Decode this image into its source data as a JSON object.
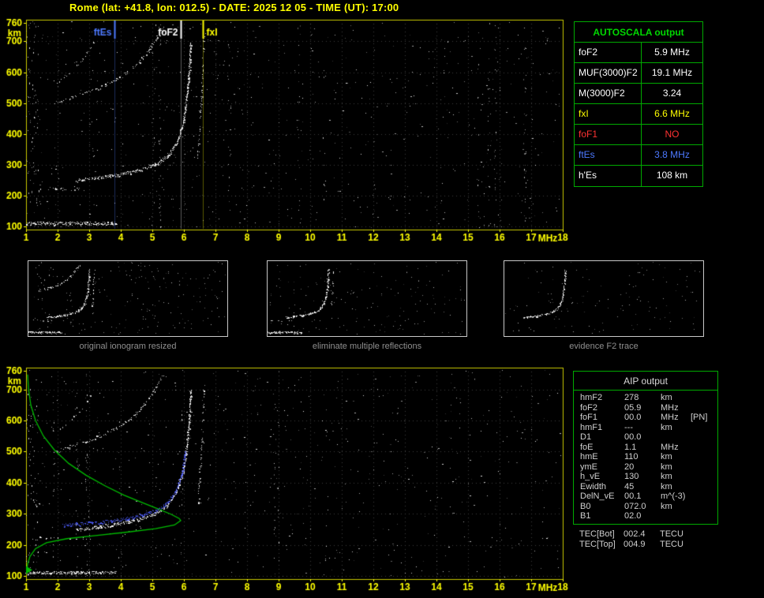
{
  "header": {
    "title": "Rome (lat: +41.8, lon: 012.5) - DATE: 2025 12 05 - TIME (UT): 17:00"
  },
  "colors": {
    "axis_yellow": "#ffff00",
    "plot_border": "#c8c800",
    "table_border_green": "#00aa00",
    "header_green": "#00d800",
    "value_white": "#ffffff",
    "value_yellow": "#ffff00",
    "value_red": "#ff3232",
    "value_blue": "#4d79ff",
    "caption_gray": "#8f8f8f",
    "profile_green": "#00bb00",
    "trace_blue": "#4d5dff"
  },
  "autoscala": {
    "header": "AUTOSCALA output",
    "rows": [
      {
        "label": "foF2",
        "value": "5.9",
        "unit": "MHz",
        "color": "#ffffff"
      },
      {
        "label": "MUF(3000)F2",
        "value": "19.1",
        "unit": "MHz",
        "color": "#ffffff"
      },
      {
        "label": "M(3000)F2",
        "value": "3.24",
        "unit": "",
        "color": "#ffffff"
      },
      {
        "label": "fxI",
        "value": "6.6",
        "unit": "MHz",
        "color": "#ffff00"
      },
      {
        "label": "foF1",
        "value": "NO",
        "unit": "",
        "color": "#ff3232"
      },
      {
        "label": "ftEs",
        "value": "3.8",
        "unit": "MHz",
        "color": "#4d79ff"
      },
      {
        "label": "h'Es",
        "value": "108",
        "unit": "km",
        "color": "#ffffff"
      }
    ]
  },
  "aip": {
    "header": "AIP output",
    "rows": [
      {
        "label": "hmF2",
        "value": "278",
        "unit": "km",
        "extra": ""
      },
      {
        "label": "foF2",
        "value": "05.9",
        "unit": "MHz",
        "extra": ""
      },
      {
        "label": "foF1",
        "value": "00.0",
        "unit": "MHz",
        "extra": "[PN]"
      },
      {
        "label": "hmF1",
        "value": "---",
        "unit": "km",
        "extra": ""
      },
      {
        "label": "D1",
        "value": "00.0",
        "unit": "",
        "extra": ""
      },
      {
        "label": "foE",
        "value": "1.1",
        "unit": "MHz",
        "extra": ""
      },
      {
        "label": "hmE",
        "value": "110",
        "unit": "km",
        "extra": ""
      },
      {
        "label": "ymE",
        "value": "20",
        "unit": "km",
        "extra": ""
      },
      {
        "label": "h_vE",
        "value": "130",
        "unit": "km",
        "extra": ""
      },
      {
        "label": "Ewidth",
        "value": "45",
        "unit": "km",
        "extra": ""
      },
      {
        "label": "DelN_vE",
        "value": "00.1",
        "unit": "m^(-3)",
        "extra": ""
      },
      {
        "label": "B0",
        "value": "072.0",
        "unit": "km",
        "extra": ""
      },
      {
        "label": "B1",
        "value": "02.0",
        "unit": "",
        "extra": ""
      }
    ],
    "tec_rows": [
      {
        "label": "TEC[Bot]",
        "value": "002.4",
        "unit": "TECU"
      },
      {
        "label": "TEC[Top]",
        "value": "004.9",
        "unit": "TECU"
      }
    ]
  },
  "chart_data": [
    {
      "id": "top_ionogram",
      "type": "scatter",
      "title": "ionogram with autoscaled characteristics",
      "xlabel": "MHz",
      "ylabel": "km",
      "xlim": [
        1,
        18
      ],
      "ylim": [
        90,
        770
      ],
      "xticks": [
        1,
        2,
        3,
        4,
        5,
        6,
        7,
        8,
        9,
        10,
        11,
        12,
        13,
        14,
        15,
        16,
        17,
        18
      ],
      "yticks": [
        100,
        200,
        300,
        400,
        500,
        600,
        700,
        760
      ],
      "grid": true,
      "legend": "none",
      "markers": [
        {
          "label": "ftEs",
          "freq": 3.8,
          "color": "#4d79ff",
          "side": "left"
        },
        {
          "label": "foF2",
          "freq": 5.9,
          "color": "#ffffff",
          "side": "left"
        },
        {
          "label": "fxI",
          "freq": 6.6,
          "color": "#ffff00",
          "side": "right"
        }
      ],
      "traces": {
        "es": {
          "points": [
            [
              1.0,
              110
            ],
            [
              3.85,
              110
            ]
          ],
          "density": 0.95,
          "thick": 2,
          "passes": 2
        },
        "es_multiple": {
          "points": [
            [
              1.2,
              220
            ],
            [
              3.1,
              222
            ]
          ],
          "density": 0.3,
          "thick": 2
        },
        "f2": {
          "points": [
            [
              2.6,
              248
            ],
            [
              3.2,
              256
            ],
            [
              4.0,
              268
            ],
            [
              4.6,
              282
            ],
            [
              5.1,
              300
            ],
            [
              5.5,
              328
            ],
            [
              5.8,
              375
            ],
            [
              6.0,
              440
            ],
            [
              6.1,
              520
            ],
            [
              6.18,
              600
            ],
            [
              6.22,
              695
            ]
          ],
          "density": 0.9,
          "thick": 2,
          "passes": 2
        },
        "f2_multiple": {
          "points": [
            [
              1.9,
              498
            ],
            [
              2.4,
              515
            ],
            [
              2.9,
              532
            ],
            [
              3.4,
              552
            ],
            [
              3.9,
              577
            ],
            [
              4.3,
              605
            ],
            [
              4.6,
              635
            ],
            [
              4.9,
              672
            ],
            [
              5.15,
              710
            ],
            [
              5.35,
              745
            ]
          ],
          "density": 0.65,
          "thick": 2
        },
        "f2_multiple3": {
          "points": [
            [
              2.0,
              565
            ],
            [
              2.4,
              600
            ],
            [
              2.8,
              640
            ],
            [
              3.1,
              685
            ],
            [
              3.3,
              730
            ]
          ],
          "density": 0.22,
          "thick": 1
        },
        "x_mode": {
          "points": [
            [
              6.45,
              320
            ],
            [
              6.52,
              440
            ],
            [
              6.58,
              560
            ],
            [
              6.62,
              660
            ],
            [
              6.65,
              715
            ]
          ],
          "density": 0.4,
          "thick": 1
        }
      },
      "noise": {
        "dots": 650,
        "left_band_dots": 80,
        "streaks": 9
      }
    },
    {
      "id": "bottom_ionogram",
      "type": "scatter",
      "title": "ionogram with restored trace and electron density profile",
      "xlabel": "MHz",
      "ylabel": "km",
      "xlim": [
        1,
        18
      ],
      "ylim": [
        90,
        770
      ],
      "xticks": [
        1,
        2,
        3,
        4,
        5,
        6,
        7,
        8,
        9,
        10,
        11,
        12,
        13,
        14,
        15,
        16,
        17,
        18
      ],
      "yticks": [
        100,
        200,
        300,
        400,
        500,
        600,
        700,
        760
      ],
      "grid": true,
      "legend": "none",
      "markers": [],
      "traces_from": "top_ionogram",
      "overlays": {
        "profile": {
          "color": "#00bb00",
          "points": [
            [
              1.05,
              748
            ],
            [
              1.08,
              700
            ],
            [
              1.15,
              650
            ],
            [
              1.3,
              600
            ],
            [
              1.55,
              550
            ],
            [
              1.9,
              505
            ],
            [
              2.35,
              462
            ],
            [
              2.9,
              424
            ],
            [
              3.5,
              390
            ],
            [
              4.1,
              360
            ],
            [
              4.7,
              335
            ],
            [
              5.2,
              315
            ],
            [
              5.6,
              298
            ],
            [
              5.85,
              285
            ],
            [
              5.9,
              278
            ],
            [
              5.7,
              264
            ],
            [
              5.1,
              252
            ],
            [
              4.2,
              241
            ],
            [
              3.2,
              230
            ],
            [
              2.3,
              220
            ],
            [
              1.65,
              207
            ],
            [
              1.3,
              188
            ],
            [
              1.12,
              162
            ],
            [
              1.05,
              138
            ],
            [
              1.02,
              120
            ]
          ]
        },
        "arrow": {
          "color": "#00bb00",
          "freq": 1.05,
          "km": 119
        },
        "blue_trace": {
          "color": "#4d5dff",
          "points": [
            [
              2.15,
              262
            ],
            [
              2.6,
              266
            ],
            [
              3.1,
              270
            ],
            [
              3.7,
              276
            ],
            [
              4.2,
              284
            ],
            [
              4.7,
              295
            ],
            [
              5.1,
              308
            ],
            [
              5.45,
              330
            ],
            [
              5.75,
              370
            ],
            [
              5.95,
              430
            ],
            [
              6.05,
              500
            ]
          ],
          "density": 0.9,
          "thick": 2,
          "passes": 2
        }
      },
      "noise": {
        "dots": 600,
        "left_band_dots": 70,
        "streaks": 8
      }
    },
    {
      "id": "thumbnails",
      "type": "scatter",
      "traces_from": "top_ionogram",
      "panels": [
        {
          "caption": "original ionogram resized",
          "traces": [
            "es",
            "es_multiple",
            "f2",
            "f2_multiple",
            "f2_multiple3",
            "x_mode"
          ],
          "noise": 220
        },
        {
          "caption": "eliminate multiple reflections",
          "traces": [
            "es",
            "es_multiple",
            "f2",
            "x_mode"
          ],
          "noise": 170
        },
        {
          "caption": "evidence F2 trace",
          "traces": [
            "f2"
          ],
          "noise": 130
        }
      ]
    }
  ]
}
